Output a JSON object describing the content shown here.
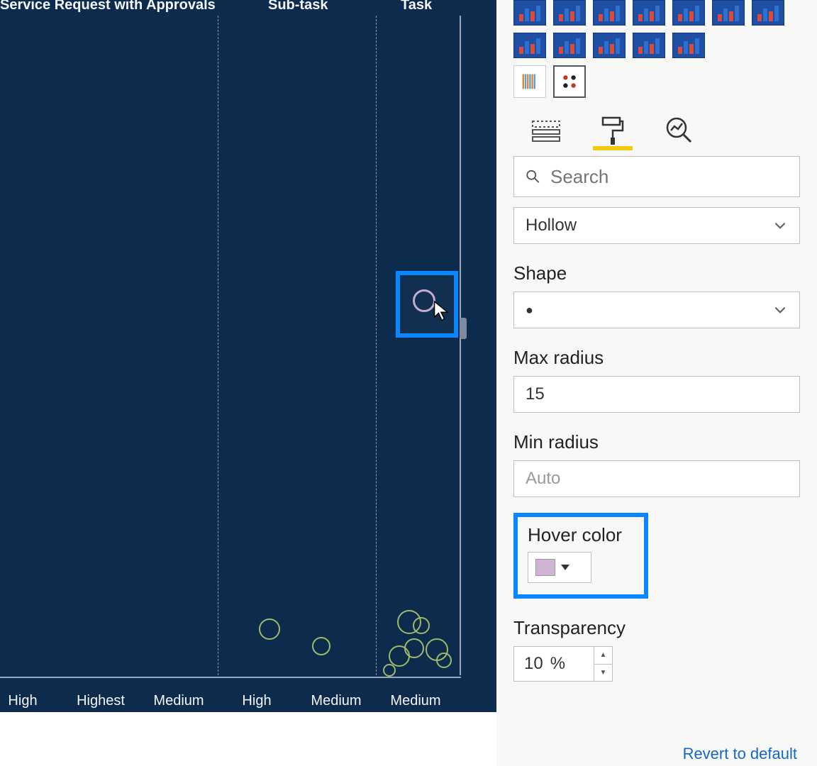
{
  "chart_data": {
    "type": "scatter",
    "column_headers": [
      "Service Request with Approvals",
      "Sub-task",
      "Task"
    ],
    "x_ticks": [
      "High",
      "Highest",
      "Medium",
      "High",
      "Medium",
      "Medium"
    ],
    "hovered_point": {
      "column": "Task",
      "x_tick": "Medium"
    },
    "marker_style": "Hollow",
    "hover_color": "#d1b3d4"
  },
  "panel": {
    "search_placeholder": "Search",
    "marker_style": {
      "value": "Hollow"
    },
    "shape": {
      "label": "Shape",
      "value": "●"
    },
    "max_radius": {
      "label": "Max radius",
      "value": "15"
    },
    "min_radius": {
      "label": "Min radius",
      "placeholder": "Auto"
    },
    "hover_color": {
      "label": "Hover color",
      "swatch": "#d1b3d4"
    },
    "transparency": {
      "label": "Transparency",
      "value": "10",
      "unit": "%"
    },
    "revert_label": "Revert to default"
  }
}
